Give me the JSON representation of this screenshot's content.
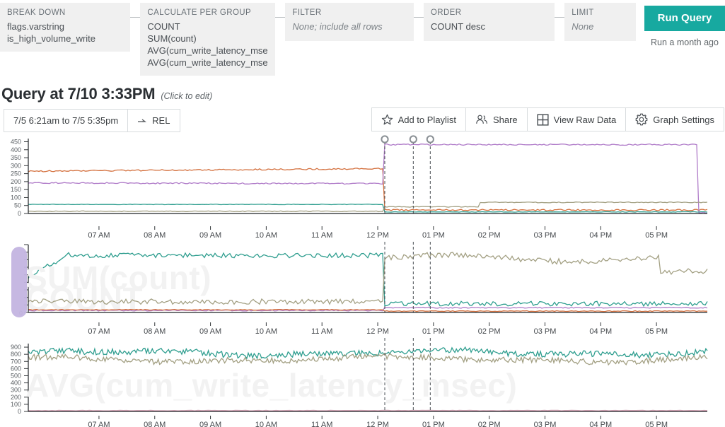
{
  "query_builder": {
    "sections": [
      {
        "label": "BREAK DOWN",
        "values": [
          "flags.varstring",
          "is_high_volume_write"
        ],
        "muted": false
      },
      {
        "label": "CALCULATE PER GROUP",
        "values": [
          "COUNT",
          "SUM(count)",
          "AVG(cum_write_latency_msec)",
          "AVG(cum_write_latency_msec)"
        ],
        "muted": false
      },
      {
        "label": "FILTER",
        "values": [
          "None; include all rows"
        ],
        "muted": true
      },
      {
        "label": "ORDER",
        "values": [
          "COUNT desc"
        ],
        "muted": false
      },
      {
        "label": "LIMIT",
        "values": [
          "None"
        ],
        "muted": true
      }
    ],
    "run_button": "Run Query",
    "run_status": "Run a month ago",
    "accent_color": "#17a9a0"
  },
  "header": {
    "title": "Query at 7/10 3:33PM",
    "edit_hint": "(Click to edit)"
  },
  "toolbar": {
    "time_range": "7/5 6:21am to 7/5 5:35pm",
    "rel_label": "REL",
    "actions": [
      {
        "label": "Add to Playlist",
        "icon": "star-icon"
      },
      {
        "label": "Share",
        "icon": "people-icon"
      },
      {
        "label": "View Raw Data",
        "icon": "grid-icon"
      },
      {
        "label": "Graph Settings",
        "icon": "gear-icon"
      }
    ]
  },
  "chart_data": [
    {
      "type": "line",
      "title": "COUNT",
      "watermark": "COUNT",
      "xlabel": "",
      "ylabel": "",
      "grid": false,
      "legend": "none",
      "xtick_labels": [
        "07 AM",
        "08 AM",
        "09 AM",
        "10 AM",
        "11 AM",
        "12 PM",
        "01 PM",
        "02 PM",
        "03 PM",
        "04 PM",
        "05 PM"
      ],
      "ytick_labels": [
        "0",
        "50",
        "100",
        "150",
        "200",
        "250",
        "300",
        "350",
        "400",
        "450"
      ],
      "ylim": [
        0,
        470
      ],
      "markers": [
        {
          "x_label": "12:30 PM",
          "style": "dashed-with-handle"
        },
        {
          "x_label": "12:55 PM",
          "style": "dashed-with-handle"
        },
        {
          "x_label": "01:05 PM",
          "style": "dashed-with-handle"
        }
      ],
      "series": [
        {
          "name": "orange-series",
          "color": "#d4713f",
          "before_break": 265,
          "after_break": 22,
          "note": "drops at break; slight upward drift before break"
        },
        {
          "name": "purple-series",
          "color": "#b07cc9",
          "before_break": 192,
          "after_break": 432,
          "note": "jumps up at break"
        },
        {
          "name": "teal-series",
          "color": "#2f9e8f",
          "before_break": 57,
          "after_break": 10,
          "note": "flat"
        },
        {
          "name": "olive-series",
          "color": "#a3a083",
          "before_break": 14,
          "after_break": 42,
          "note": "steps up mid-afternoon to ~70"
        }
      ]
    },
    {
      "type": "line",
      "title": "SUM(count)",
      "watermark": "SUM(count)",
      "xlabel": "",
      "ylabel": "",
      "grid": false,
      "legend": "none",
      "xtick_labels": [
        "07 AM",
        "08 AM",
        "09 AM",
        "10 AM",
        "11 AM",
        "12 PM",
        "01 PM",
        "02 PM",
        "03 PM",
        "04 PM",
        "05 PM"
      ],
      "ytick_labels": [
        "0"
      ],
      "ylim": [
        0,
        100
      ],
      "note": "y-axis tick labels are obscured by a lavender drag-handle overlay",
      "markers": [
        {
          "x_label": "12:30 PM",
          "style": "dashed"
        },
        {
          "x_label": "12:55 PM",
          "style": "dashed"
        },
        {
          "x_label": "01:05 PM",
          "style": "dashed"
        }
      ],
      "series": [
        {
          "name": "teal-series",
          "color": "#2f9e8f",
          "before_break": 86,
          "after_break": 13,
          "note": "high noisy line then drops at break"
        },
        {
          "name": "olive-series",
          "color": "#a3a083",
          "before_break": 16,
          "after_break": 80,
          "note": "jumps up at break, noisy, sags late"
        },
        {
          "name": "purple-series",
          "color": "#b07cc9",
          "before_break": 3,
          "after_break": 7,
          "note": "low flat"
        },
        {
          "name": "orange-series",
          "color": "#d4713f",
          "before_break": 4,
          "after_break": 2,
          "note": "lowest flat"
        }
      ]
    },
    {
      "type": "line",
      "title": "AVG(cum_write_latency_msec)",
      "watermark": "AVG(cum_write_latency_msec)",
      "xlabel": "",
      "ylabel": "",
      "grid": false,
      "legend": "none",
      "xtick_labels": [
        "07 AM",
        "08 AM",
        "09 AM",
        "10 AM",
        "11 AM",
        "12 PM",
        "01 PM",
        "02 PM",
        "03 PM",
        "04 PM",
        "05 PM"
      ],
      "ytick_labels": [
        "0",
        "100",
        "200",
        "300",
        "400",
        "500",
        "600",
        "700",
        "800",
        "900"
      ],
      "ylim": [
        0,
        950
      ],
      "markers": [
        {
          "x_label": "12:30 PM",
          "style": "dashed"
        },
        {
          "x_label": "12:55 PM",
          "style": "dashed"
        },
        {
          "x_label": "01:05 PM",
          "style": "dashed"
        }
      ],
      "series": [
        {
          "name": "teal-series",
          "color": "#2f9e8f",
          "mean": 820,
          "min": 700,
          "max": 930,
          "note": "noisy high band across full range"
        },
        {
          "name": "olive-series",
          "color": "#a3a083",
          "mean": 730,
          "min": 620,
          "max": 860,
          "note": "noisy band just below teal"
        },
        {
          "name": "pink-series",
          "color": "#d3a3b4",
          "mean": 12,
          "min": 5,
          "max": 20,
          "note": "near-zero flat line"
        }
      ]
    }
  ]
}
